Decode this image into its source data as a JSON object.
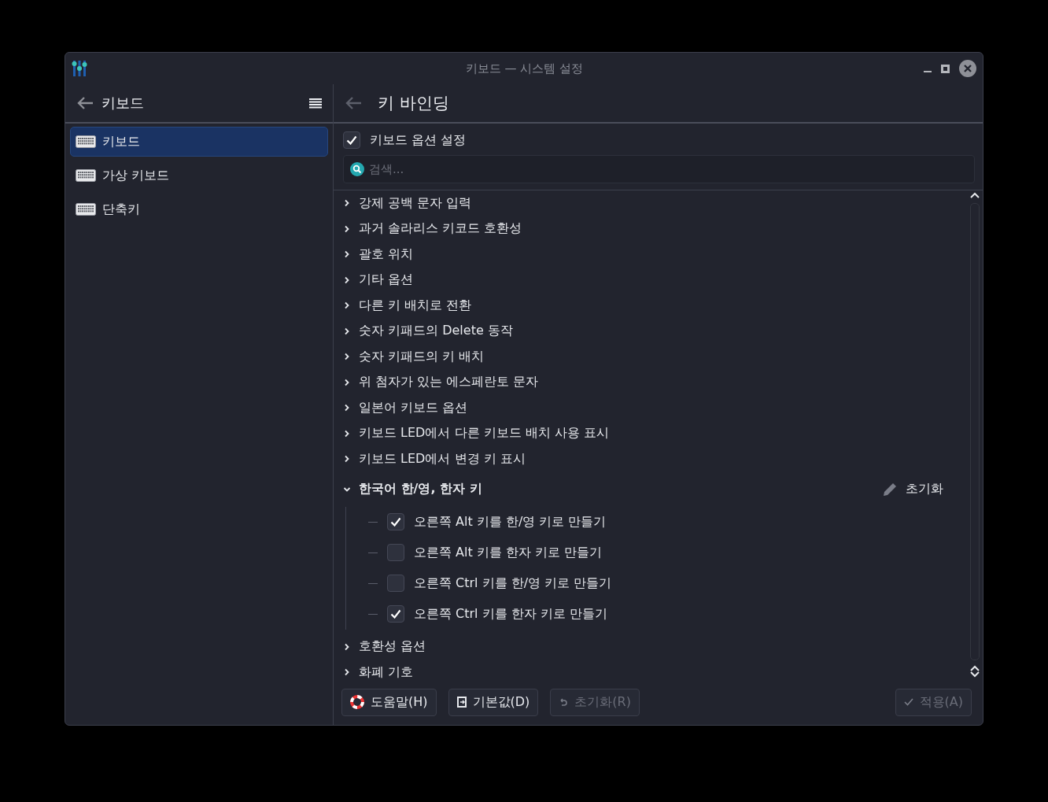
{
  "window": {
    "title": "키보드 — 시스템 설정"
  },
  "sidebar": {
    "title": "키보드",
    "items": [
      {
        "label": "키보드",
        "selected": true
      },
      {
        "label": "가상 키보드",
        "selected": false
      },
      {
        "label": "단축키",
        "selected": false
      }
    ]
  },
  "page": {
    "title": "키 바인딩",
    "enable": {
      "label": "키보드 옵션 설정",
      "checked": true
    },
    "search": {
      "placeholder": "검색..."
    },
    "groups": [
      {
        "label": "강제 공백 문자 입력",
        "expanded": false
      },
      {
        "label": "과거 솔라리스 키코드 호환성",
        "expanded": false
      },
      {
        "label": "괄호 위치",
        "expanded": false
      },
      {
        "label": "기타 옵션",
        "expanded": false
      },
      {
        "label": "다른 키 배치로 전환",
        "expanded": false
      },
      {
        "label": "숫자 키패드의 Delete 동작",
        "expanded": false
      },
      {
        "label": "숫자 키패드의 키 배치",
        "expanded": false
      },
      {
        "label": "위 첨자가 있는 에스페란토 문자",
        "expanded": false
      },
      {
        "label": "일본어 키보드 옵션",
        "expanded": false
      },
      {
        "label": "키보드 LED에서 다른 키보드 배치 사용 표시",
        "expanded": false
      },
      {
        "label": "키보드 LED에서 변경 키 표시",
        "expanded": false
      },
      {
        "label": "한국어 한/영, 한자 키",
        "expanded": true,
        "reset_label": "초기화",
        "children": [
          {
            "label": "오른쪽 Alt 키를 한/영 키로 만들기",
            "checked": true
          },
          {
            "label": "오른쪽 Alt 키를 한자 키로 만들기",
            "checked": false
          },
          {
            "label": "오른쪽 Ctrl 키를 한/영 키로 만들기",
            "checked": false
          },
          {
            "label": "오른쪽 Ctrl 키를 한자 키로 만들기",
            "checked": true
          }
        ]
      },
      {
        "label": "호환성 옵션",
        "expanded": false
      },
      {
        "label": "화폐 기호",
        "expanded": false
      }
    ]
  },
  "buttons": [
    {
      "kind": "help",
      "label": "도움말(H)",
      "disabled": false
    },
    {
      "kind": "defaults",
      "label": "기본값(D)",
      "disabled": false
    },
    {
      "kind": "reset",
      "label": "초기화(R)",
      "disabled": true
    },
    {
      "kind": "apply",
      "label": "적용(A)",
      "disabled": true
    }
  ]
}
